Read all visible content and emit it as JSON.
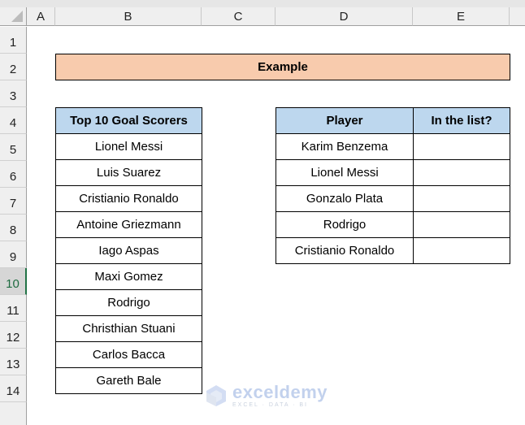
{
  "sheet": {
    "columns": [
      "A",
      "B",
      "C",
      "D",
      "E"
    ],
    "rows": [
      "1",
      "2",
      "3",
      "4",
      "5",
      "6",
      "7",
      "8",
      "9",
      "10",
      "11",
      "12",
      "13",
      "14"
    ],
    "selected_row": "10"
  },
  "banner": {
    "title": "Example",
    "fill_color": "#f8cbad"
  },
  "scorers_table": {
    "header": "Top 10 Goal Scorers",
    "header_color": "#bdd7ee",
    "items": [
      "Lionel Messi",
      "Luis Suarez",
      "Cristianio Ronaldo",
      "Antoine Griezmann",
      "Iago Aspas",
      "Maxi Gomez",
      "Rodrigo",
      "Christhian Stuani",
      "Carlos Bacca",
      "Gareth Bale"
    ]
  },
  "players_table": {
    "headers": [
      "Player",
      "In the list?"
    ],
    "rows": [
      {
        "player": "Karim Benzema",
        "in_list": ""
      },
      {
        "player": "Lionel Messi",
        "in_list": ""
      },
      {
        "player": "Gonzalo Plata",
        "in_list": ""
      },
      {
        "player": "Rodrigo",
        "in_list": ""
      },
      {
        "player": "Cristianio Ronaldo",
        "in_list": ""
      }
    ]
  },
  "watermark": {
    "brand": "exceldemy",
    "tagline": "EXCEL · DATA · BI",
    "icon": "exceldemy-logo-icon"
  }
}
